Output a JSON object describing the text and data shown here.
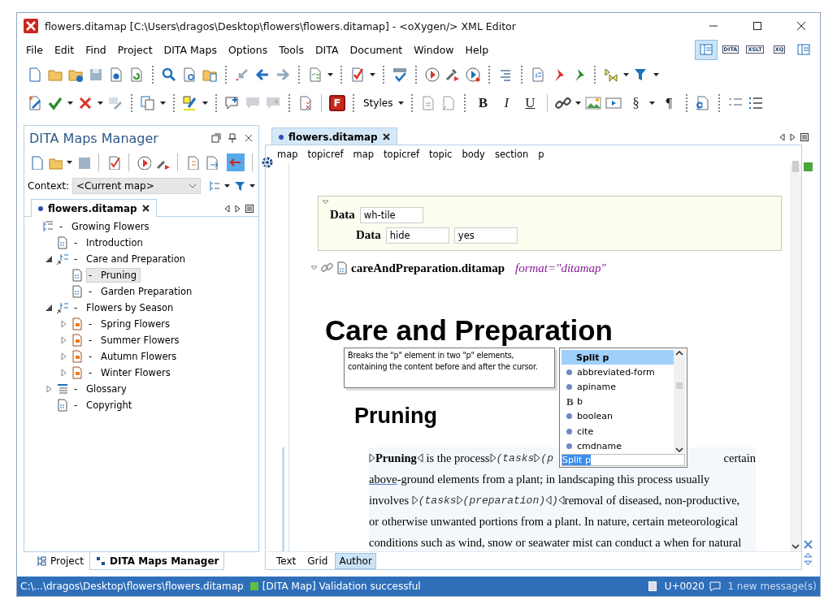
{
  "window": {
    "title": "flowers.ditamap [C:\\Users\\dragos\\Desktop\\flowers\\flowers.ditamap] - <oXygen/> XML Editor"
  },
  "menu": [
    "File",
    "Edit",
    "Find",
    "Project",
    "DITA Maps",
    "Options",
    "Tools",
    "DITA",
    "Document",
    "Window",
    "Help"
  ],
  "perspectives": [
    {
      "selected": true
    },
    {
      "label": "DITA",
      "selected": false
    },
    {
      "label": "XSLT",
      "selected": false
    },
    {
      "label": "XQ",
      "selected": false
    },
    {
      "selected": false
    }
  ],
  "toolbar": {
    "badge_button": "F",
    "styles_label": "Styles",
    "format_buttons": [
      "B",
      "I",
      "U"
    ],
    "section_button": "§",
    "pilcrow_button": "¶"
  },
  "maps_manager": {
    "title": "DITA Maps Manager",
    "context_label": "Context:",
    "context_value": "<Current map>",
    "tab": {
      "label": "flowers.ditamap",
      "selected": true
    },
    "tree": [
      {
        "label": "-   Growing Flowers",
        "kind": "map",
        "selected": false,
        "children": [
          {
            "label": "-   Introduction",
            "kind": "topic",
            "selected": false
          },
          {
            "label": "-   Care and Preparation",
            "kind": "submap",
            "expanded": true,
            "selected": false,
            "children": [
              {
                "label": "-   Pruning",
                "kind": "topic",
                "selected": true
              },
              {
                "label": "-   Garden Preparation",
                "kind": "topic",
                "selected": false
              }
            ]
          },
          {
            "label": "-   Flowers by Season",
            "kind": "submap",
            "expanded": true,
            "selected": false,
            "children": [
              {
                "label": "-   Spring Flowers",
                "kind": "chapter",
                "expanded": false,
                "selected": false
              },
              {
                "label": "-   Summer Flowers",
                "kind": "chapter",
                "expanded": false,
                "selected": false
              },
              {
                "label": "-   Autumn Flowers",
                "kind": "chapter",
                "expanded": false,
                "selected": false
              },
              {
                "label": "-   Winter Flowers",
                "kind": "chapter",
                "expanded": false,
                "selected": false
              }
            ]
          },
          {
            "label": "-   Glossary",
            "kind": "glossary",
            "expanded": false,
            "selected": false
          },
          {
            "label": "-   Copyright",
            "kind": "topic",
            "selected": false
          }
        ]
      }
    ],
    "bottom_tabs": [
      {
        "label": "Project",
        "selected": false
      },
      {
        "label": "DITA Maps Manager",
        "selected": true
      }
    ]
  },
  "editor": {
    "tab": {
      "label": "flowers.ditamap",
      "selected": true
    },
    "breadcrumb": [
      "map",
      "topicref",
      "map",
      "topicref",
      "topic",
      "body",
      "section",
      "p"
    ],
    "data_block": [
      {
        "label": "Data",
        "fields": [
          "wh-tile"
        ]
      },
      {
        "label": "Data",
        "fields": [
          "hide",
          "yes"
        ]
      }
    ],
    "topicref": {
      "href": "careAndPreparation.ditamap",
      "attribute": "format=\"ditamap\""
    },
    "heading": "Care and Preparation",
    "tooltip": "Breaks the \"p\" element in two \"p\" elements, containing the content before and after the cursor.",
    "subheading": "Pruning",
    "paragraph": [
      {
        "left": [
          {
            "kind": "start"
          },
          {
            "kind": "bold",
            "text": "Pruning"
          },
          {
            "kind": "end"
          },
          {
            "kind": "text",
            "text": " is the process"
          },
          {
            "kind": "start"
          },
          {
            "kind": "code",
            "text": "(tasks"
          },
          {
            "kind": "start"
          },
          {
            "kind": "code",
            "text": "(p"
          }
        ],
        "right": [
          {
            "kind": "text",
            "text": "certain"
          }
        ]
      },
      {
        "left": [
          {
            "kind": "underlined",
            "text": "above"
          },
          {
            "kind": "text",
            "text": "-ground elements from a plant; in landscaping this process usually"
          }
        ]
      },
      {
        "left": [
          {
            "kind": "text",
            "text": "involves "
          },
          {
            "kind": "start"
          },
          {
            "kind": "code",
            "text": "(tasks"
          },
          {
            "kind": "start"
          },
          {
            "kind": "code",
            "text": "(preparation)"
          },
          {
            "kind": "end"
          },
          {
            "kind": "code",
            "text": ")"
          },
          {
            "kind": "end"
          },
          {
            "kind": "text",
            "text": "removal of diseased, non-productive,"
          }
        ]
      },
      {
        "left": [
          {
            "kind": "text",
            "text": "or otherwise unwanted portions from a plant. In nature, certain meteorological"
          }
        ]
      },
      {
        "left": [
          {
            "kind": "text",
            "text": "conditions such as wind, snow or seawater mist can conduct a when for natural"
          }
        ]
      }
    ],
    "popup": {
      "items": [
        {
          "label": "Split p",
          "kind": "action",
          "selected": true
        },
        {
          "label": "abbreviated-form",
          "kind": "element",
          "selected": false
        },
        {
          "label": "apiname",
          "kind": "element",
          "selected": false
        },
        {
          "label": "b",
          "kind": "bold",
          "badge": "B",
          "selected": false
        },
        {
          "label": "boolean",
          "kind": "element",
          "selected": false
        },
        {
          "label": "cite",
          "kind": "element",
          "selected": false
        },
        {
          "label": "cmdname",
          "kind": "element",
          "selected": false
        }
      ],
      "filter": "Split p"
    },
    "modes": [
      {
        "label": "Text",
        "selected": false
      },
      {
        "label": "Grid",
        "selected": false
      },
      {
        "label": "Author",
        "selected": true
      }
    ]
  },
  "status_bar": {
    "path": "C:\\...\\dragos\\Desktop\\flowers\\flowers.ditamap",
    "validation": "[DITA Map] Validation successful",
    "char": "U+0020",
    "messages": "1 new message(s)"
  }
}
